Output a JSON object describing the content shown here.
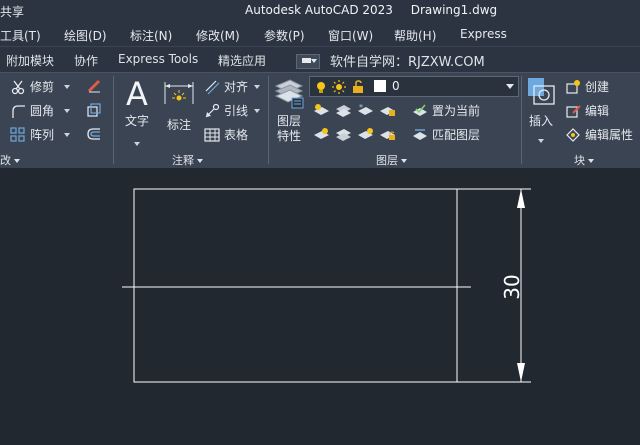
{
  "titlebar": {
    "left_fragment": "共享",
    "app_name": "Autodesk AutoCAD 2023",
    "file_name": "Drawing1.dwg"
  },
  "menu": [
    {
      "label": "工具(T)"
    },
    {
      "label": "绘图(D)"
    },
    {
      "label": "标注(N)"
    },
    {
      "label": "修改(M)"
    },
    {
      "label": "参数(P)"
    },
    {
      "label": "窗口(W)"
    },
    {
      "label": "帮助(H)"
    },
    {
      "label": "Express"
    }
  ],
  "tabs": [
    {
      "label": "附加模块"
    },
    {
      "label": "协作"
    },
    {
      "label": "Express Tools"
    },
    {
      "label": "精选应用"
    }
  ],
  "watermark_text": "软件自学网：RJZXW.COM",
  "modify_panel": {
    "trim": "修剪",
    "fillet": "圆角",
    "array": "阵列",
    "title_fragment": "改"
  },
  "annotation_panel": {
    "text": "文字",
    "dimension": "标注",
    "align": "对齐",
    "leader": "引线",
    "table": "表格",
    "title": "注释"
  },
  "layers_panel": {
    "layer_properties_line1": "图层",
    "layer_properties_line2": "特性",
    "current_layer": "0",
    "set_current": "置为当前",
    "match_layer": "匹配图层",
    "title": "图层"
  },
  "block_panel": {
    "insert": "插入",
    "create": "创建",
    "edit": "编辑",
    "edit_attributes": "编辑属性",
    "title": "块"
  },
  "drawing": {
    "dimension_value": "30"
  },
  "colors": {
    "canvas_bg": "#212830",
    "ribbon_bg": "#3b4453",
    "bar_bg": "#2b3440",
    "line_white": "#ffffff",
    "layer_bulb": "#f5c518",
    "lock_yellow": "#e8b020",
    "pen_red": "#e05a4a"
  }
}
